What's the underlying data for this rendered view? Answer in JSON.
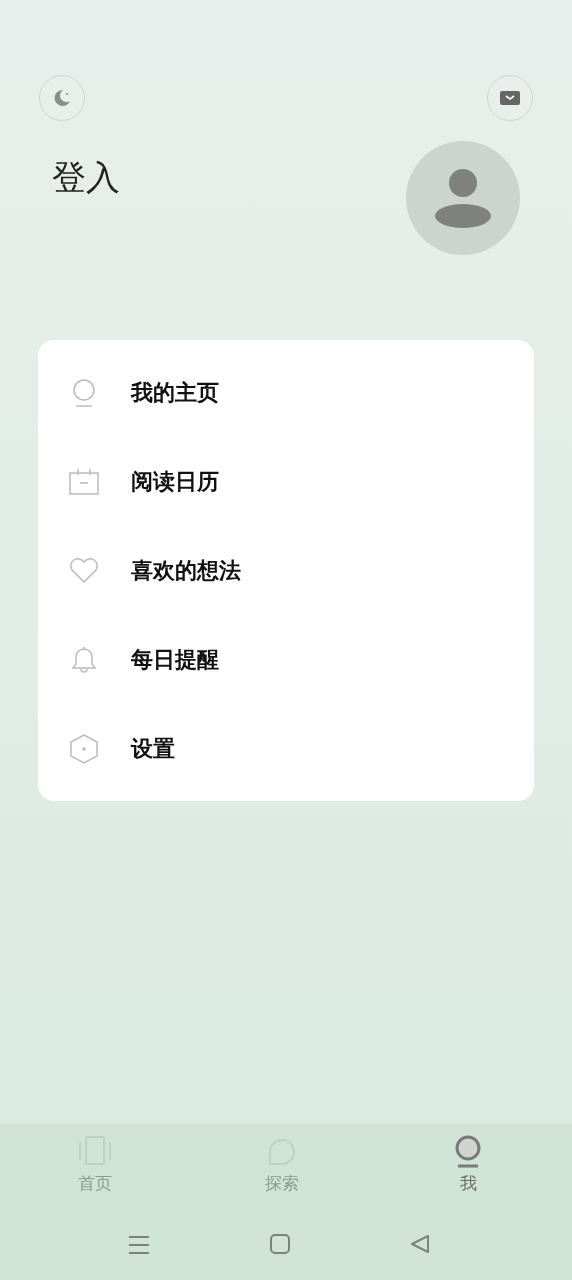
{
  "header": {
    "title": "登入"
  },
  "menu": [
    {
      "kind": "profile",
      "label": "我的主页"
    },
    {
      "kind": "calendar",
      "label": "阅读日历"
    },
    {
      "kind": "heart",
      "label": "喜欢的想法"
    },
    {
      "kind": "bell",
      "label": "每日提醒"
    },
    {
      "kind": "settings",
      "label": "设置"
    }
  ],
  "tabs": [
    {
      "kind": "home",
      "label": "首页",
      "selected": false
    },
    {
      "kind": "explore",
      "label": "探索",
      "selected": false
    },
    {
      "kind": "me",
      "label": "我",
      "selected": true
    }
  ]
}
